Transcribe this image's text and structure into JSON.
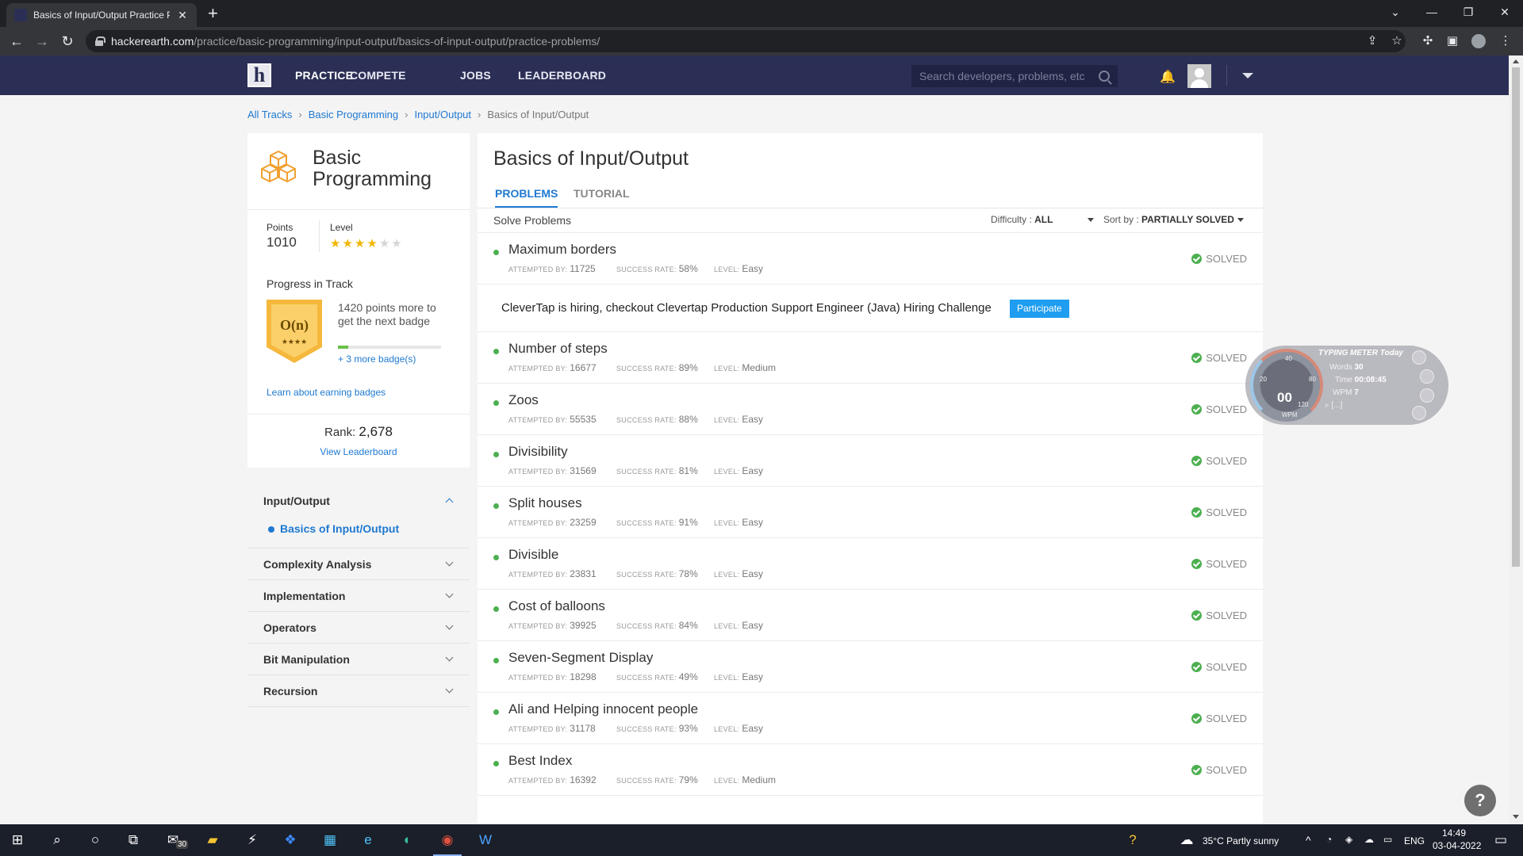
{
  "browser": {
    "tab_title": "Basics of Input/Output Practice P",
    "url_host": "hackerearth.com",
    "url_path": "/practice/basic-programming/input-output/basics-of-input-output/practice-problems/"
  },
  "header": {
    "nav": [
      "PRACTICE",
      "COMPETE",
      "JOBS",
      "LEADERBOARD"
    ],
    "search_placeholder": "Search developers, problems, etc"
  },
  "breadcrumb": [
    "All Tracks",
    "Basic Programming",
    "Input/Output",
    "Basics of Input/Output"
  ],
  "track": {
    "title_line1": "Basic",
    "title_line2": "Programming",
    "points_label": "Points",
    "points": "1010",
    "level_label": "Level",
    "level_stars": 4,
    "level_max": 6,
    "progress_title": "Progress in Track",
    "badge_label": "O(n)",
    "badge_stars": "★★★★",
    "badge_text": "1420 points more to get the next badge",
    "badge_progress": 0.1,
    "more_badges": "+ 3 more badge(s)",
    "learn_link": "Learn about earning badges",
    "rank_label": "Rank:",
    "rank": "2,678",
    "view_leaderboard": "View Leaderboard"
  },
  "sidenav": {
    "expanded_label": "Input/Output",
    "active_sub": "Basics of Input/Output",
    "items": [
      "Complexity Analysis",
      "Implementation",
      "Operators",
      "Bit Manipulation",
      "Recursion"
    ]
  },
  "main": {
    "title": "Basics of Input/Output",
    "tabs": [
      "PROBLEMS",
      "TUTORIAL"
    ],
    "solve_label": "Solve Problems",
    "difficulty_label": "Difficulty :",
    "difficulty_value": "ALL",
    "sort_label": "Sort by :",
    "sort_value": "PARTIALLY SOLVED",
    "meta_labels": {
      "attempted": "ATTEMPTED BY:",
      "success": "SUCCESS RATE:",
      "level": "LEVEL:"
    },
    "problems": [
      {
        "name": "Maximum borders",
        "attempted": "11725",
        "success": "58%",
        "level": "Easy",
        "status": "SOLVED"
      },
      {
        "name": "Number of steps",
        "attempted": "16677",
        "success": "89%",
        "level": "Medium",
        "status": "SOLVED"
      },
      {
        "name": "Zoos",
        "attempted": "55535",
        "success": "88%",
        "level": "Easy",
        "status": "SOLVED"
      },
      {
        "name": "Divisibility",
        "attempted": "31569",
        "success": "81%",
        "level": "Easy",
        "status": "SOLVED"
      },
      {
        "name": "Split houses",
        "attempted": "23259",
        "success": "91%",
        "level": "Easy",
        "status": "SOLVED"
      },
      {
        "name": "Divisible",
        "attempted": "23831",
        "success": "78%",
        "level": "Easy",
        "status": "SOLVED"
      },
      {
        "name": "Cost of balloons",
        "attempted": "39925",
        "success": "84%",
        "level": "Easy",
        "status": "SOLVED"
      },
      {
        "name": "Seven-Segment Display",
        "attempted": "18298",
        "success": "49%",
        "level": "Easy",
        "status": "SOLVED"
      },
      {
        "name": "Ali and Helping innocent people",
        "attempted": "31178",
        "success": "93%",
        "level": "Easy",
        "status": "SOLVED"
      },
      {
        "name": "Best Index",
        "attempted": "16392",
        "success": "79%",
        "level": "Medium",
        "status": "SOLVED"
      }
    ],
    "hiring_text": "CleverTap is hiring, checkout Clevertap Production Support Engineer (Java) Hiring Challenge",
    "participate": "Participate"
  },
  "typing_meter": {
    "title": "TYPING METER Today",
    "words_label": "Words",
    "words": "30",
    "time_label": "Time",
    "time": "00:08:45",
    "wpm_label": "WPM",
    "wpm": "7",
    "gauge_value": "00",
    "gauge_unit": "WPM",
    "gauge_ticks": [
      "20",
      "40",
      "80",
      "120"
    ]
  },
  "taskbar": {
    "mail_badge": "30",
    "weather": "35°C  Partly sunny",
    "lang": "ENG",
    "time": "14:49",
    "date": "03-04-2022"
  },
  "colors": {
    "header": "#2b2f55",
    "link": "#1f79d1",
    "solved": "#4caf50",
    "participate": "#1f9df0"
  }
}
